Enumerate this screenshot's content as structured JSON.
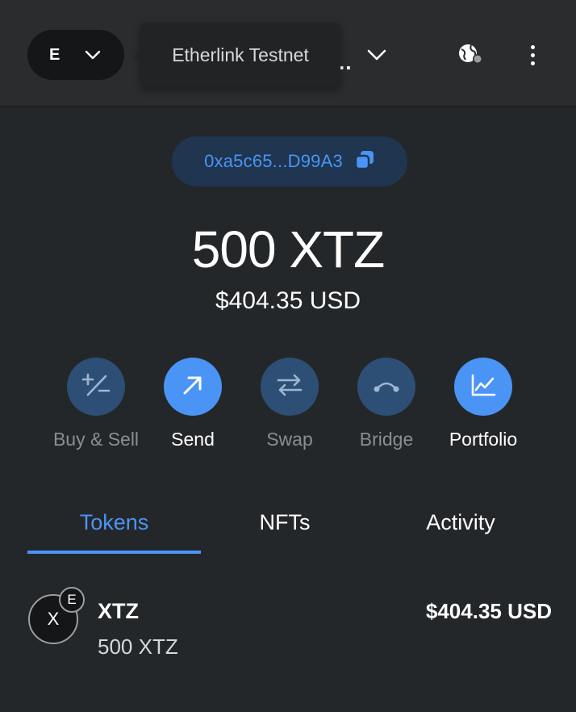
{
  "header": {
    "network_avatar": "E",
    "network_tooltip": "Etherlink Testnet",
    "account_ellipsis": "..",
    "icons": {
      "network_chevron": "chevron-down-icon",
      "account_chevron": "chevron-down-icon",
      "globe": "globe-icon",
      "menu": "kebab-menu-icon"
    }
  },
  "account": {
    "address": "0xa5c65...D99A3",
    "copy_icon": "copy-icon"
  },
  "balance": {
    "amount": "500 XTZ",
    "fiat": "$404.35 USD"
  },
  "actions": [
    {
      "label": "Buy & Sell",
      "icon": "plus-minus-icon",
      "enabled": false
    },
    {
      "label": "Send",
      "icon": "arrow-up-right-icon",
      "enabled": true
    },
    {
      "label": "Swap",
      "icon": "swap-arrows-icon",
      "enabled": false
    },
    {
      "label": "Bridge",
      "icon": "bridge-icon",
      "enabled": false
    },
    {
      "label": "Portfolio",
      "icon": "chart-icon",
      "enabled": true
    }
  ],
  "tabs": [
    {
      "label": "Tokens",
      "active": true
    },
    {
      "label": "NFTs",
      "active": false
    },
    {
      "label": "Activity",
      "active": false
    }
  ],
  "tokens": [
    {
      "icon_letter": "X",
      "badge_letter": "E",
      "name": "XTZ",
      "amount": "500 XTZ",
      "fiat": "$404.35 USD"
    }
  ],
  "colors": {
    "accent": "#4a94f5",
    "background": "#24272a",
    "header_bg": "#2b2c2e",
    "disabled_circle": "#2e4f75",
    "disabled_label": "#8a8d91"
  }
}
